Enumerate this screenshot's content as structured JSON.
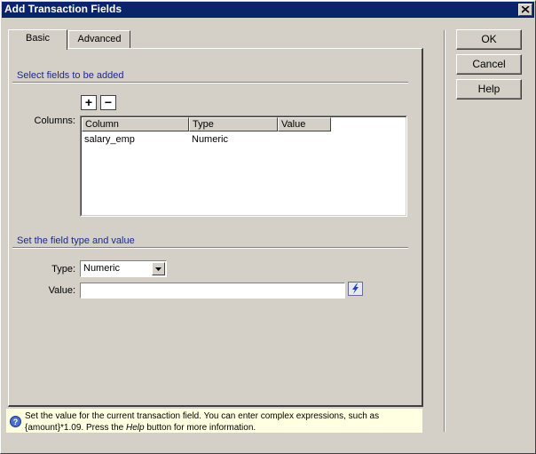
{
  "window": {
    "title": "Add Transaction Fields",
    "close_symbol": "✕"
  },
  "tabs": [
    {
      "label": "Basic",
      "active": true
    },
    {
      "label": "Advanced",
      "active": false
    }
  ],
  "fields_section": {
    "header": "Select fields to be added",
    "add_symbol": "+",
    "remove_symbol": "−",
    "columns_label": "Columns:",
    "table": {
      "headers": [
        "Column",
        "Type",
        "Value"
      ],
      "rows": [
        {
          "column": "salary_emp",
          "type": "Numeric",
          "value": ""
        }
      ]
    }
  },
  "type_section": {
    "header": "Set the field type and value",
    "type_label": "Type:",
    "type_value": "Numeric",
    "value_label": "Value:",
    "value_input": ""
  },
  "buttons": {
    "ok": "OK",
    "cancel": "Cancel",
    "help": "Help"
  },
  "help_bar": {
    "text_before": "Set the value for the current transaction field. You can enter complex expressions, such as {amount}*1.09. Press the ",
    "help_word": "Help",
    "text_after": " button for more information."
  },
  "colors": {
    "titlebar": "#0a246a",
    "section_label": "#1a2a86",
    "help_bar_bg": "#ffffe1"
  }
}
